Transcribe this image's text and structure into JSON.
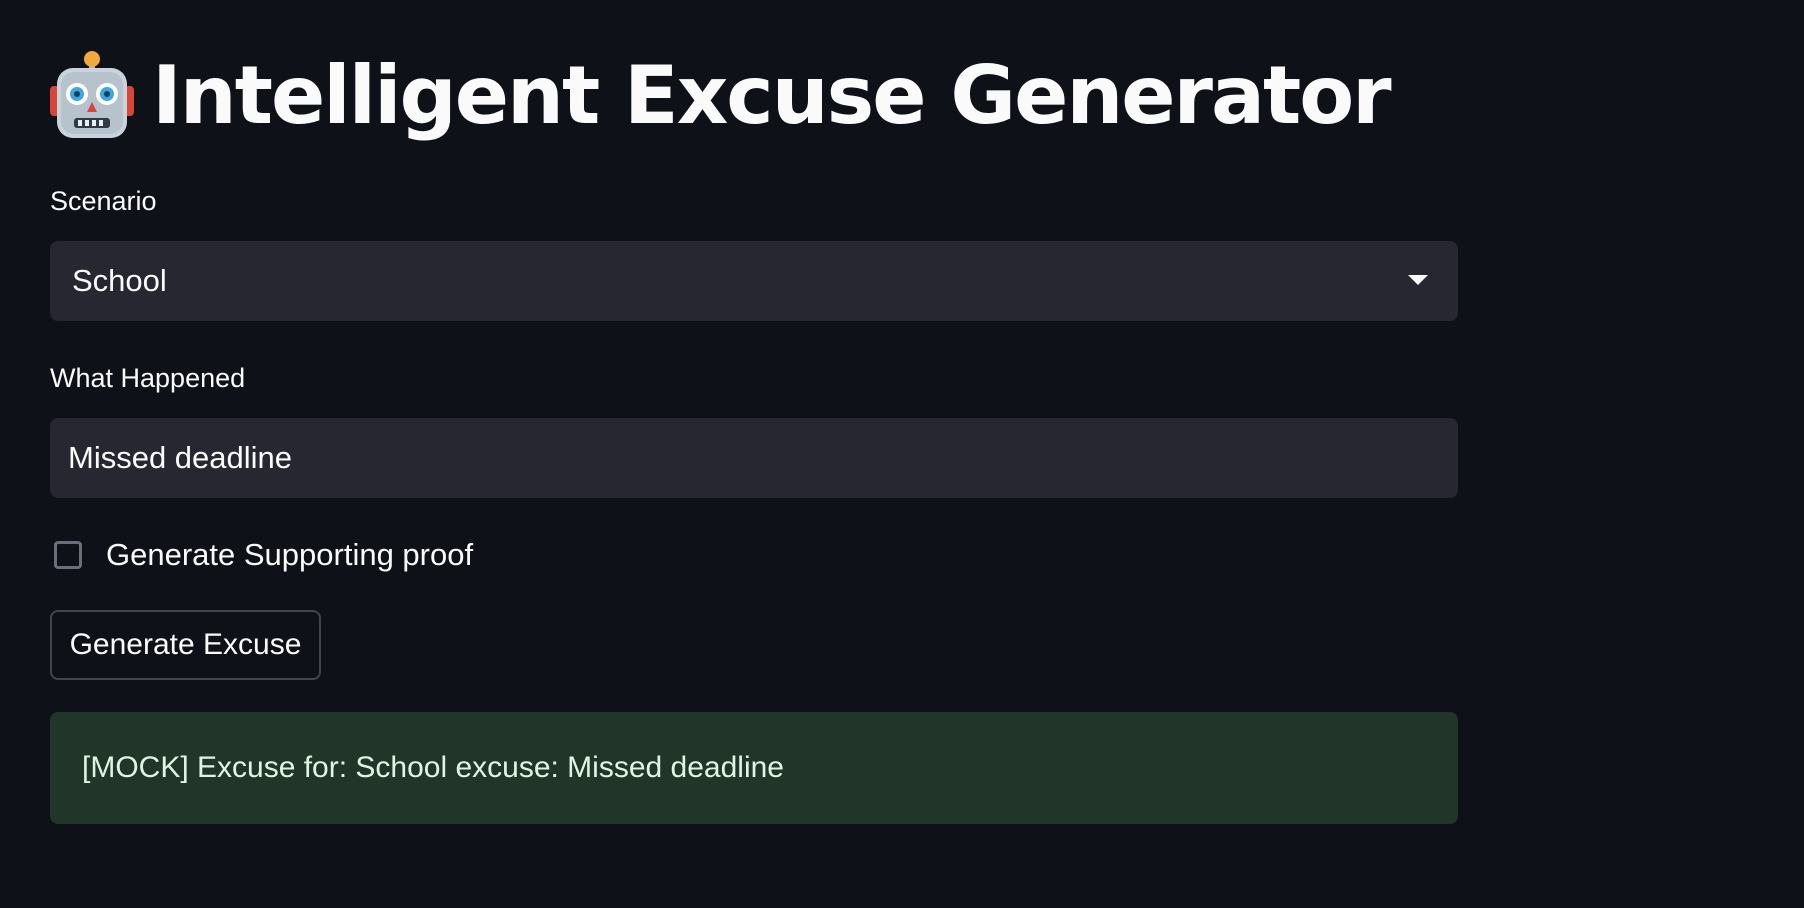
{
  "header": {
    "title": "Intelligent Excuse Generator",
    "icon": "robot-icon"
  },
  "form": {
    "scenario": {
      "label": "Scenario",
      "selected": "School"
    },
    "what_happened": {
      "label": "What Happened",
      "value": "Missed deadline"
    },
    "proof_checkbox": {
      "label": "Generate Supporting proof",
      "checked": false
    },
    "submit_label": "Generate Excuse"
  },
  "result": {
    "message": "[MOCK] Excuse for: School excuse: Missed deadline"
  },
  "colors": {
    "background": "#0e1117",
    "input_background": "#262730",
    "success_background": "#213628",
    "text": "#fafafa"
  }
}
